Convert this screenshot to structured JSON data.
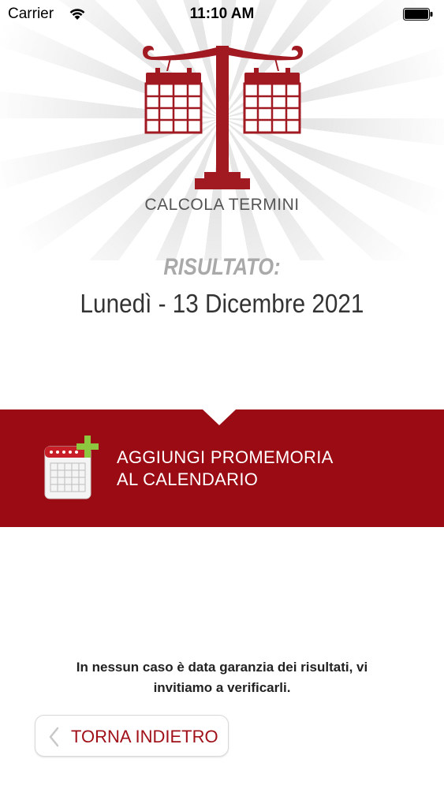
{
  "status_bar": {
    "carrier": "Carrier",
    "time": "11:10 AM"
  },
  "header": {
    "logo_icon": "scales-calendar-icon",
    "app_title": "CALCOLA TERMINI"
  },
  "result": {
    "label": "RISULTATO:",
    "value": "Lunedì - 13 Dicembre 2021"
  },
  "reminder_banner": {
    "icon": "calendar-add-icon",
    "line1": "AGGIUNGI PROMEMORIA",
    "line2": "AL CALENDARIO"
  },
  "disclaimer": {
    "line1": "In nessun caso è data garanzia dei risultati, vi",
    "line2": "invitiamo a verificarli."
  },
  "back_button": {
    "icon": "chevron-left-icon",
    "label": "TORNA INDIETRO"
  },
  "colors": {
    "brand_red": "#9a0b13",
    "logo_red": "#a11a22",
    "plus_green": "#8dc63f"
  }
}
